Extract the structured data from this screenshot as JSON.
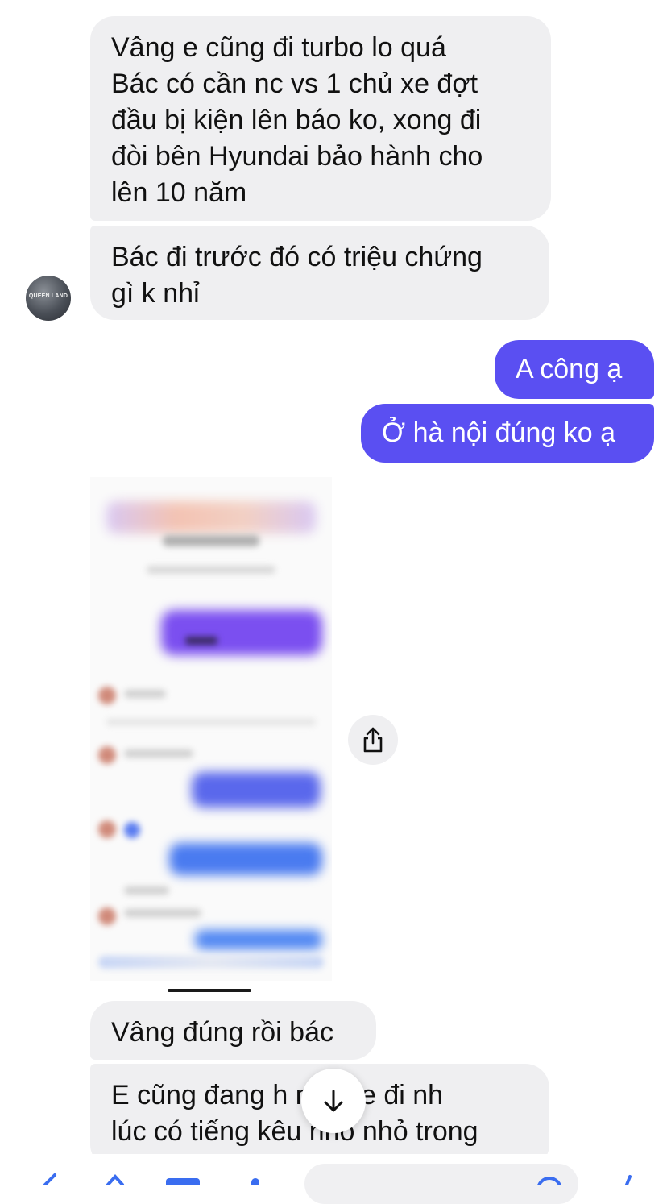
{
  "messages": [
    {
      "id": "b1",
      "direction": "incoming",
      "text": "Vâng e cũng đi turbo lo quá\nBác có cần nc vs 1 chủ xe đợt\nđầu bị kiện lên báo ko, xong đi\nđòi bên Hyundai bảo hành cho\nlên 10 năm"
    },
    {
      "id": "b2",
      "direction": "incoming",
      "text": "Bác đi trước đó có triệu chứng\ngì k nhỉ"
    },
    {
      "id": "b3",
      "direction": "outgoing",
      "text": "A công ạ"
    },
    {
      "id": "b4",
      "direction": "outgoing",
      "text": "Ở hà nội đúng ko ạ"
    },
    {
      "id": "b5",
      "direction": "incoming",
      "text": "Vâng đúng rồi bác"
    },
    {
      "id": "b6",
      "direction": "incoming",
      "text": "E cũng đang h        n vì xe đi nh\nlúc có tiếng kêu      nho nhỏ trong"
    }
  ],
  "avatar": {
    "text": "QUEEN LAND"
  },
  "icons": {
    "share": "share-icon",
    "scroll_down": "arrow-down-icon"
  },
  "colors": {
    "outgoing_bubble": "#5a4ff2",
    "incoming_bubble": "#efeff1",
    "background": "#ffffff"
  }
}
